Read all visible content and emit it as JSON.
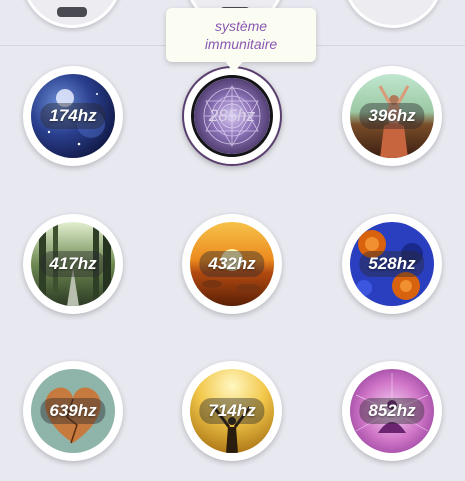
{
  "tooltip": {
    "line1": "système",
    "line2": "immunitaire"
  },
  "frequencies": [
    {
      "id": "174",
      "label": "174hz",
      "theme": "night-sky"
    },
    {
      "id": "285",
      "label": "285hz",
      "theme": "mandala",
      "selected": true
    },
    {
      "id": "396",
      "label": "396hz",
      "theme": "joyful-woman"
    },
    {
      "id": "417",
      "label": "417hz",
      "theme": "forest-path"
    },
    {
      "id": "432",
      "label": "432hz",
      "theme": "sunset"
    },
    {
      "id": "528",
      "label": "528hz",
      "theme": "blue-roses"
    },
    {
      "id": "639",
      "label": "639hz",
      "theme": "heart"
    },
    {
      "id": "714",
      "label": "714hz",
      "theme": "raised-arms"
    },
    {
      "id": "852",
      "label": "852hz",
      "theme": "meditation"
    }
  ],
  "colors": {
    "background": "#e8e9f0",
    "tooltip_text": "#8a57b2",
    "tooltip_bg": "#fcfdf2",
    "label_pill": "rgba(40,40,46,0.42)"
  }
}
